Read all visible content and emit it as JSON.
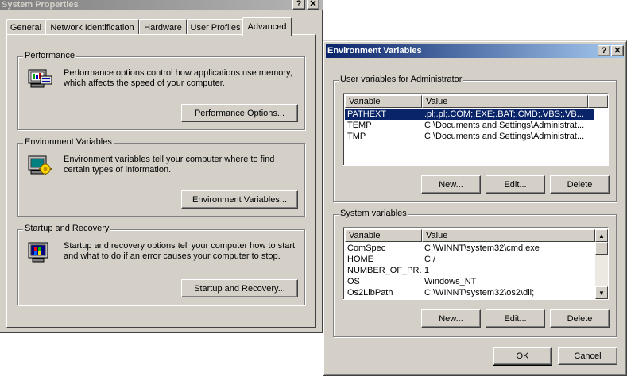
{
  "system_properties": {
    "title": "System Properties",
    "help_label": "?",
    "close_label": "✕",
    "tabs": [
      {
        "label": "General"
      },
      {
        "label": "Network Identification"
      },
      {
        "label": "Hardware"
      },
      {
        "label": "User Profiles"
      },
      {
        "label": "Advanced",
        "active": true
      }
    ],
    "performance": {
      "title": "Performance",
      "description": "Performance options control how applications use memory, which affects the speed of your computer.",
      "button_label": "Performance Options..."
    },
    "environment": {
      "title": "Environment Variables",
      "description": "Environment variables tell your computer where to find certain types of information.",
      "button_label": "Environment Variables..."
    },
    "startup": {
      "title": "Startup and Recovery",
      "description": "Startup and recovery options tell your computer how to start and what to do if an error causes your computer to stop.",
      "button_label": "Startup and Recovery..."
    }
  },
  "environment_variables": {
    "title": "Environment Variables",
    "help_label": "?",
    "close_label": "✕",
    "user_group_title": "User variables for Administrator",
    "system_group_title": "System variables",
    "columns": {
      "variable": "Variable",
      "value": "Value"
    },
    "user_vars": [
      {
        "variable": "PATHEXT",
        "value": ".pl;.pl;.COM;.EXE;.BAT;.CMD;.VBS;.VB...",
        "selected": true
      },
      {
        "variable": "TEMP",
        "value": "C:\\Documents and Settings\\Administrat..."
      },
      {
        "variable": "TMP",
        "value": "C:\\Documents and Settings\\Administrat..."
      }
    ],
    "system_vars": [
      {
        "variable": "ComSpec",
        "value": "C:\\WINNT\\system32\\cmd.exe"
      },
      {
        "variable": "HOME",
        "value": "C:/"
      },
      {
        "variable": "NUMBER_OF_PR...",
        "value": "1"
      },
      {
        "variable": "OS",
        "value": "Windows_NT"
      },
      {
        "variable": "Os2LibPath",
        "value": "C:\\WINNT\\system32\\os2\\dll;"
      }
    ],
    "buttons": {
      "new": "New...",
      "edit": "Edit...",
      "delete": "Delete",
      "ok": "OK",
      "cancel": "Cancel"
    },
    "colors": {
      "selection": "#0a246a",
      "title_active": "#0a246a",
      "face": "#d4d0c8"
    }
  }
}
